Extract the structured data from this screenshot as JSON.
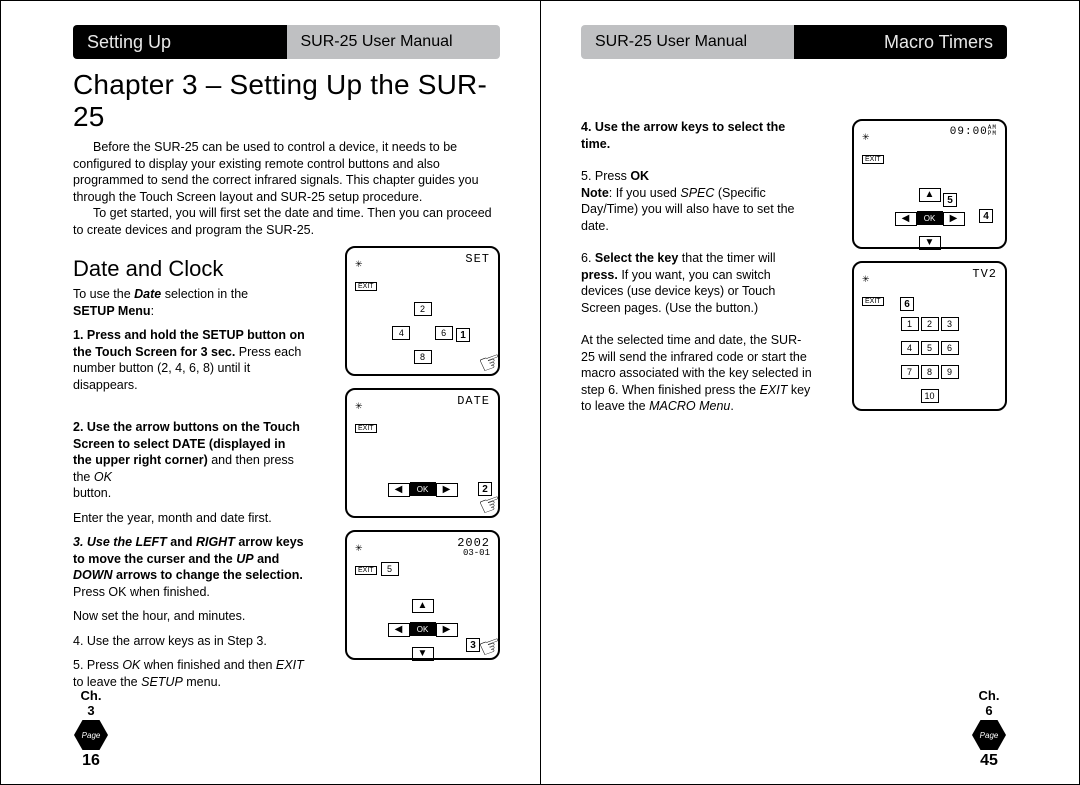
{
  "left": {
    "header_black": "Setting Up",
    "header_gray": "SUR-25 User Manual",
    "chapter": "Chapter 3 – Setting Up the SUR-25",
    "intro1": "Before the SUR-25 can be used to control a device, it needs to be configured to display your existing remote control buttons and also programmed to send the correct infrared signals. This chapter guides you through the Touch Screen layout and SUR-25 setup procedure.",
    "intro2": "To get started, you will first set the date and time. Then you can proceed to create devices and program the SUR-25.",
    "section": "Date and Clock",
    "p1a": "To  use the ",
    "p1b": "Date",
    "p1c": " selection in the ",
    "p1d": "SETUP Menu",
    "step1a": "1.   Press and hold the SETUP button on the Touch Screen for 3 sec.",
    "step1b": " Press each number button (2, 4, 6, 8)  until it disappears.",
    "step2a": "2.  Use the arrow buttons on the Touch Screen to select DATE (displayed in the upper right corner)",
    "step2b": " and  then press the ",
    "step2c": "OK",
    "step2d": "button.",
    "step2e": "Enter the year, month and date first.",
    "step3a": "3. Use the ",
    "step3_left": "LEFT",
    "step3_and": " and ",
    "step3_right": "RIGHT",
    "step3b": " arrow keys to move the curser and the ",
    "step3_up": "UP",
    "step3c": " and ",
    "step3_down": "DOWN",
    "step3d": " arrows to change the selection.",
    "step3e": " Press OK when finished.",
    "step3f": "Now set the hour, and minutes.",
    "step4": "4. Use the arrow keys as in Step 3.",
    "step5a": "5.  Press ",
    "step5_ok": "OK",
    "step5b": " when finished and then ",
    "step5_exit": "EXIT",
    "step5c": " to leave the ",
    "step5_setup": "SETUP",
    "step5d": " menu.",
    "dev1_mode": "SET",
    "dev1_exit": "EXIT",
    "dev2_mode": "DATE",
    "dev2_exit": "EXIT",
    "dev3_mode": "2002",
    "dev3_mode2": "03-01",
    "dev3_exit": "EXIT",
    "ch": "Ch.",
    "chnum": "3",
    "pagelabel": "Page",
    "page": "16"
  },
  "right": {
    "header_gray": "SUR-25 User Manual",
    "header_black": "Macro Timers",
    "step4a": "4.  Use the arrow keys to select the time.",
    "step5a": "5. Press ",
    "step5b": "OK",
    "note_lead": "Note",
    "note": ": If you used ",
    "note_spec": "SPEC",
    "note2": " (Specific Day/Time) you will also have to set the date.",
    "step6a": "6. ",
    "step6b": "Select the key",
    "step6c": " that the timer will ",
    "step6_press": "press.",
    "step6d": " If you want, you can switch devices (use device keys) or Touch Screen pages. (Use the                   button.)",
    "p7a": "At the selected time and date, the SUR-25 will send the infrared code or start the macro associated with the key selected in step 6. When finished press the ",
    "p7_exit": "EXIT",
    "p7b": " key to leave the ",
    "p7_macro": "MACRO Menu",
    "p7c": ".",
    "devA_mode": "09:00",
    "devA_exit": "EXIT",
    "devB_mode": "TV2",
    "devB_exit": "EXIT",
    "ch": "Ch.",
    "chnum": "6",
    "pagelabel": "Page",
    "page": "45"
  }
}
